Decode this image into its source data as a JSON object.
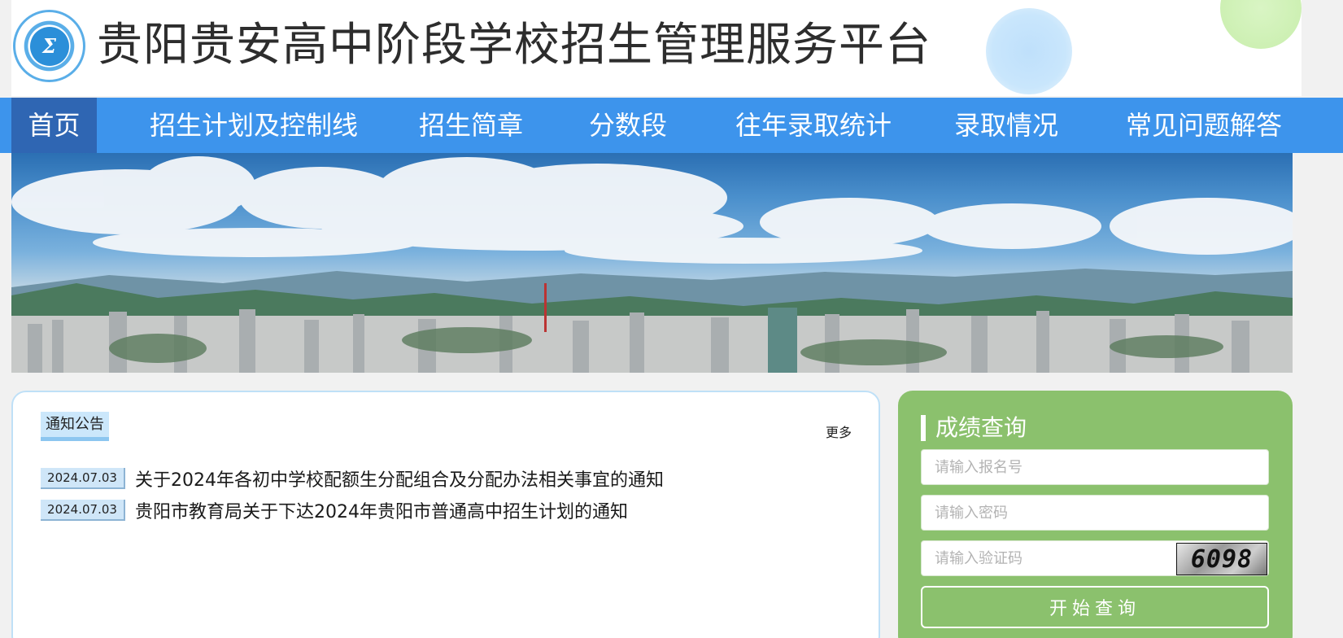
{
  "header": {
    "logo_icon": "school-admissions-logo",
    "logo_mark": "Σ",
    "title": "贵阳贵安高中阶段学校招生管理服务平台"
  },
  "nav": {
    "items": [
      {
        "label": "首页",
        "active": true
      },
      {
        "label": "招生计划及控制线",
        "active": false
      },
      {
        "label": "招生简章",
        "active": false
      },
      {
        "label": "分数段",
        "active": false
      },
      {
        "label": "往年录取统计",
        "active": false
      },
      {
        "label": "录取情况",
        "active": false
      },
      {
        "label": "常见问题解答",
        "active": false
      }
    ]
  },
  "notices": {
    "tab_label": "通知公告",
    "more_label": "更多",
    "items": [
      {
        "date": "2024.07.03",
        "title": "关于2024年各初中学校配额生分配组合及分配办法相关事宜的通知"
      },
      {
        "date": "2024.07.03",
        "title": "贵阳市教育局关于下达2024年贵阳市普通高中招生计划的通知"
      }
    ]
  },
  "query": {
    "title": "成绩查询",
    "reg_placeholder": "请输入报名号",
    "password_placeholder": "请输入密码",
    "captcha_placeholder": "请输入验证码",
    "captcha_text": "6098",
    "submit_label": "开始查询"
  },
  "colors": {
    "nav_bg": "#3d94ec",
    "nav_active": "#2f66b3",
    "query_panel": "#8bc16d"
  }
}
